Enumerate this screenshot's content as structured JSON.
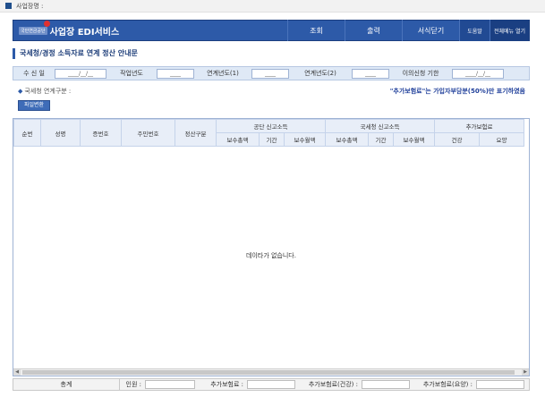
{
  "topbar": {
    "label": "사업장명 :"
  },
  "header": {
    "org_label": "국민연금공단",
    "title": "사업장 EDI서비스",
    "nav": [
      "조회",
      "출력",
      "서식닫기"
    ],
    "help": "도움말",
    "all_menu": "전체메뉴 열기"
  },
  "page_title": "국세청/경정 소득자료 연계 정산 안내문",
  "filter": {
    "receipt_date_label": "수 신 일",
    "receipt_date_value": "____/__/__",
    "work_year_label": "작업년도",
    "work_year_value": "____",
    "link_year1_label": "연계년도(1)",
    "link_year1_value": "____",
    "link_year2_label": "연계년도(2)",
    "link_year2_value": "____",
    "deadline_label": "이의신청 기한",
    "deadline_value": "____/__/__"
  },
  "section_label": "국세청 연계구분 :",
  "notice": "\"추가보험료\"는 가입자부담분(50%)만 표기하였음",
  "file_button": "파일변환",
  "table": {
    "col_seq": "순번",
    "col_name": "성명",
    "col_cert": "증번호",
    "col_rrn": "주민번호",
    "col_settle": "정산구분",
    "group_nps": "공단 신고소득",
    "group_nts": "국세청 신고소득",
    "group_extra": "추가보험료",
    "sub_total": "보수총액",
    "sub_period": "기간",
    "sub_monthly": "보수월액",
    "sub_total2": "보수총액",
    "sub_period2": "기간",
    "sub_monthly2": "보수월액",
    "sub_health": "건강",
    "sub_care": "요양",
    "empty_message": "데이타가 없습니다."
  },
  "totals": {
    "label": "총계",
    "persons_label": "인원 :",
    "extra_label": "추가보험료 :",
    "extra_health_label": "추가보험료(건강) :",
    "extra_care_label": "추가보험료(요양) :"
  }
}
